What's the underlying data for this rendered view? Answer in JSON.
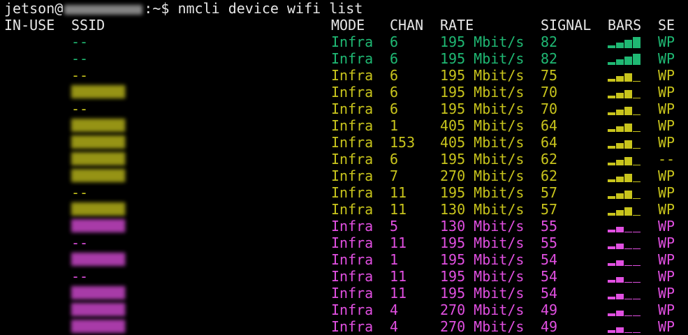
{
  "prompt": {
    "user": "jetson@",
    "suffix": ":~$ nmcli device wifi list"
  },
  "header": {
    "in_use": "IN-USE",
    "ssid": "SSID",
    "mode": "MODE",
    "chan": "CHAN",
    "rate": "RATE",
    "signal": "SIGNAL",
    "bars": "BARS",
    "security": "SE"
  },
  "colors": {
    "strong": "#1fb873",
    "medium": "#c8c41c",
    "weak": "#e14fe1",
    "bar_track": "#555555",
    "text": "#e6e6e6"
  },
  "rows": [
    {
      "in_use": "",
      "ssid": "--",
      "ssid_blurred": false,
      "mode": "Infra",
      "chan": "6",
      "rate": "195 Mbit/s",
      "signal": "82",
      "bars_level": 4,
      "security": "WP",
      "tier": "strong"
    },
    {
      "in_use": "",
      "ssid": "--",
      "ssid_blurred": false,
      "mode": "Infra",
      "chan": "6",
      "rate": "195 Mbit/s",
      "signal": "82",
      "bars_level": 4,
      "security": "WP",
      "tier": "strong"
    },
    {
      "in_use": "",
      "ssid": "--",
      "ssid_blurred": false,
      "mode": "Infra",
      "chan": "6",
      "rate": "195 Mbit/s",
      "signal": "75",
      "bars_level": 3,
      "security": "WP",
      "tier": "medium"
    },
    {
      "in_use": "",
      "ssid": "",
      "ssid_blurred": true,
      "mode": "Infra",
      "chan": "6",
      "rate": "195 Mbit/s",
      "signal": "70",
      "bars_level": 3,
      "security": "WP",
      "tier": "medium"
    },
    {
      "in_use": "",
      "ssid": "--",
      "ssid_blurred": false,
      "mode": "Infra",
      "chan": "6",
      "rate": "195 Mbit/s",
      "signal": "70",
      "bars_level": 3,
      "security": "WP",
      "tier": "medium"
    },
    {
      "in_use": "",
      "ssid": "",
      "ssid_blurred": true,
      "mode": "Infra",
      "chan": "1",
      "rate": "405 Mbit/s",
      "signal": "64",
      "bars_level": 3,
      "security": "WP",
      "tier": "medium"
    },
    {
      "in_use": "",
      "ssid": "",
      "ssid_blurred": true,
      "mode": "Infra",
      "chan": "153",
      "rate": "405 Mbit/s",
      "signal": "64",
      "bars_level": 3,
      "security": "WP",
      "tier": "medium"
    },
    {
      "in_use": "",
      "ssid": "",
      "ssid_blurred": true,
      "mode": "Infra",
      "chan": "6",
      "rate": "195 Mbit/s",
      "signal": "62",
      "bars_level": 3,
      "security": "--",
      "tier": "medium"
    },
    {
      "in_use": "",
      "ssid": "",
      "ssid_blurred": true,
      "mode": "Infra",
      "chan": "7",
      "rate": "270 Mbit/s",
      "signal": "62",
      "bars_level": 3,
      "security": "WP",
      "tier": "medium"
    },
    {
      "in_use": "",
      "ssid": "--",
      "ssid_blurred": false,
      "mode": "Infra",
      "chan": "11",
      "rate": "195 Mbit/s",
      "signal": "57",
      "bars_level": 3,
      "security": "WP",
      "tier": "medium"
    },
    {
      "in_use": "",
      "ssid": "",
      "ssid_blurred": true,
      "mode": "Infra",
      "chan": "11",
      "rate": "130 Mbit/s",
      "signal": "57",
      "bars_level": 3,
      "security": "WP",
      "tier": "medium"
    },
    {
      "in_use": "",
      "ssid": "",
      "ssid_blurred": true,
      "mode": "Infra",
      "chan": "5",
      "rate": "130 Mbit/s",
      "signal": "55",
      "bars_level": 2,
      "security": "WP",
      "tier": "weak"
    },
    {
      "in_use": "",
      "ssid": "--",
      "ssid_blurred": false,
      "mode": "Infra",
      "chan": "11",
      "rate": "195 Mbit/s",
      "signal": "55",
      "bars_level": 2,
      "security": "WP",
      "tier": "weak"
    },
    {
      "in_use": "",
      "ssid": "",
      "ssid_blurred": true,
      "mode": "Infra",
      "chan": "1",
      "rate": "195 Mbit/s",
      "signal": "54",
      "bars_level": 2,
      "security": "WP",
      "tier": "weak"
    },
    {
      "in_use": "",
      "ssid": "--",
      "ssid_blurred": false,
      "mode": "Infra",
      "chan": "11",
      "rate": "195 Mbit/s",
      "signal": "54",
      "bars_level": 2,
      "security": "WP",
      "tier": "weak"
    },
    {
      "in_use": "",
      "ssid": "",
      "ssid_blurred": true,
      "mode": "Infra",
      "chan": "11",
      "rate": "195 Mbit/s",
      "signal": "54",
      "bars_level": 2,
      "security": "WP",
      "tier": "weak"
    },
    {
      "in_use": "",
      "ssid": "",
      "ssid_blurred": true,
      "mode": "Infra",
      "chan": "4",
      "rate": "270 Mbit/s",
      "signal": "49",
      "bars_level": 2,
      "security": "WP",
      "tier": "weak"
    },
    {
      "in_use": "",
      "ssid": "",
      "ssid_blurred": true,
      "mode": "Infra",
      "chan": "4",
      "rate": "270 Mbit/s",
      "signal": "49",
      "bars_level": 2,
      "security": "WP",
      "tier": "weak"
    }
  ]
}
